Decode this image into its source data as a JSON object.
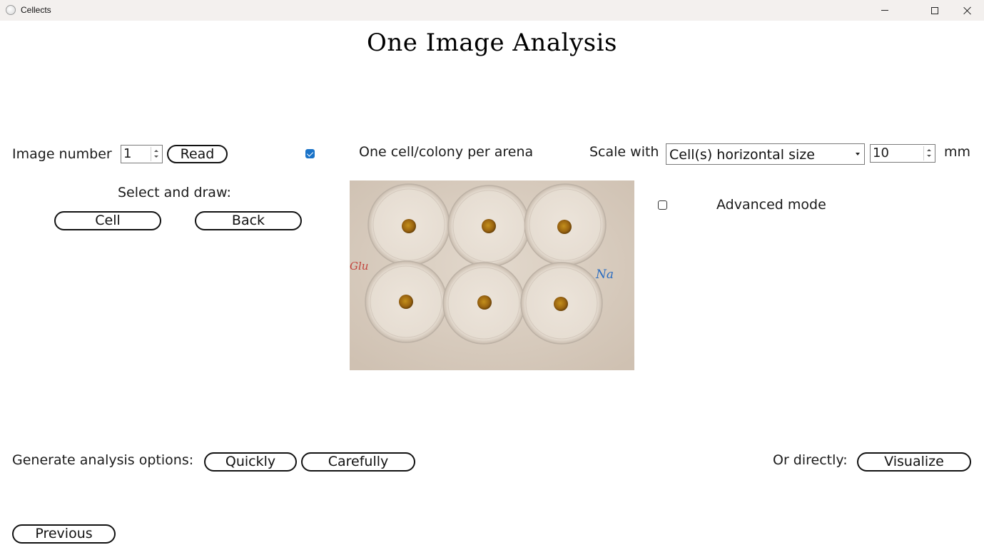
{
  "window": {
    "title": "Cellects"
  },
  "page": {
    "title": "One Image Analysis"
  },
  "controls": {
    "image_number_label": "Image number",
    "image_number_value": "1",
    "read_button": "Read",
    "one_cell_checkbox_label": "One cell/colony per arena",
    "one_cell_checked": true,
    "scale_with_label": "Scale with",
    "scale_option": "Cell(s) horizontal size",
    "scale_value": "10",
    "scale_unit": "mm",
    "select_and_draw_label": "Select and draw:",
    "cell_button": "Cell",
    "back_button": "Back",
    "advanced_mode_label": "Advanced mode",
    "advanced_mode_checked": false
  },
  "image_annotations": {
    "left_mark": "Glu",
    "right_mark": "Na"
  },
  "bottom": {
    "generate_label": "Generate analysis options:",
    "quickly_button": "Quickly",
    "carefully_button": "Carefully",
    "or_directly_label": "Or directly:",
    "visualize_button": "Visualize",
    "previous_button": "Previous"
  },
  "colors": {
    "checkbox_accent": "#1a73c8",
    "petri_background": "#dbcfc3",
    "colony": "#a06a10"
  }
}
